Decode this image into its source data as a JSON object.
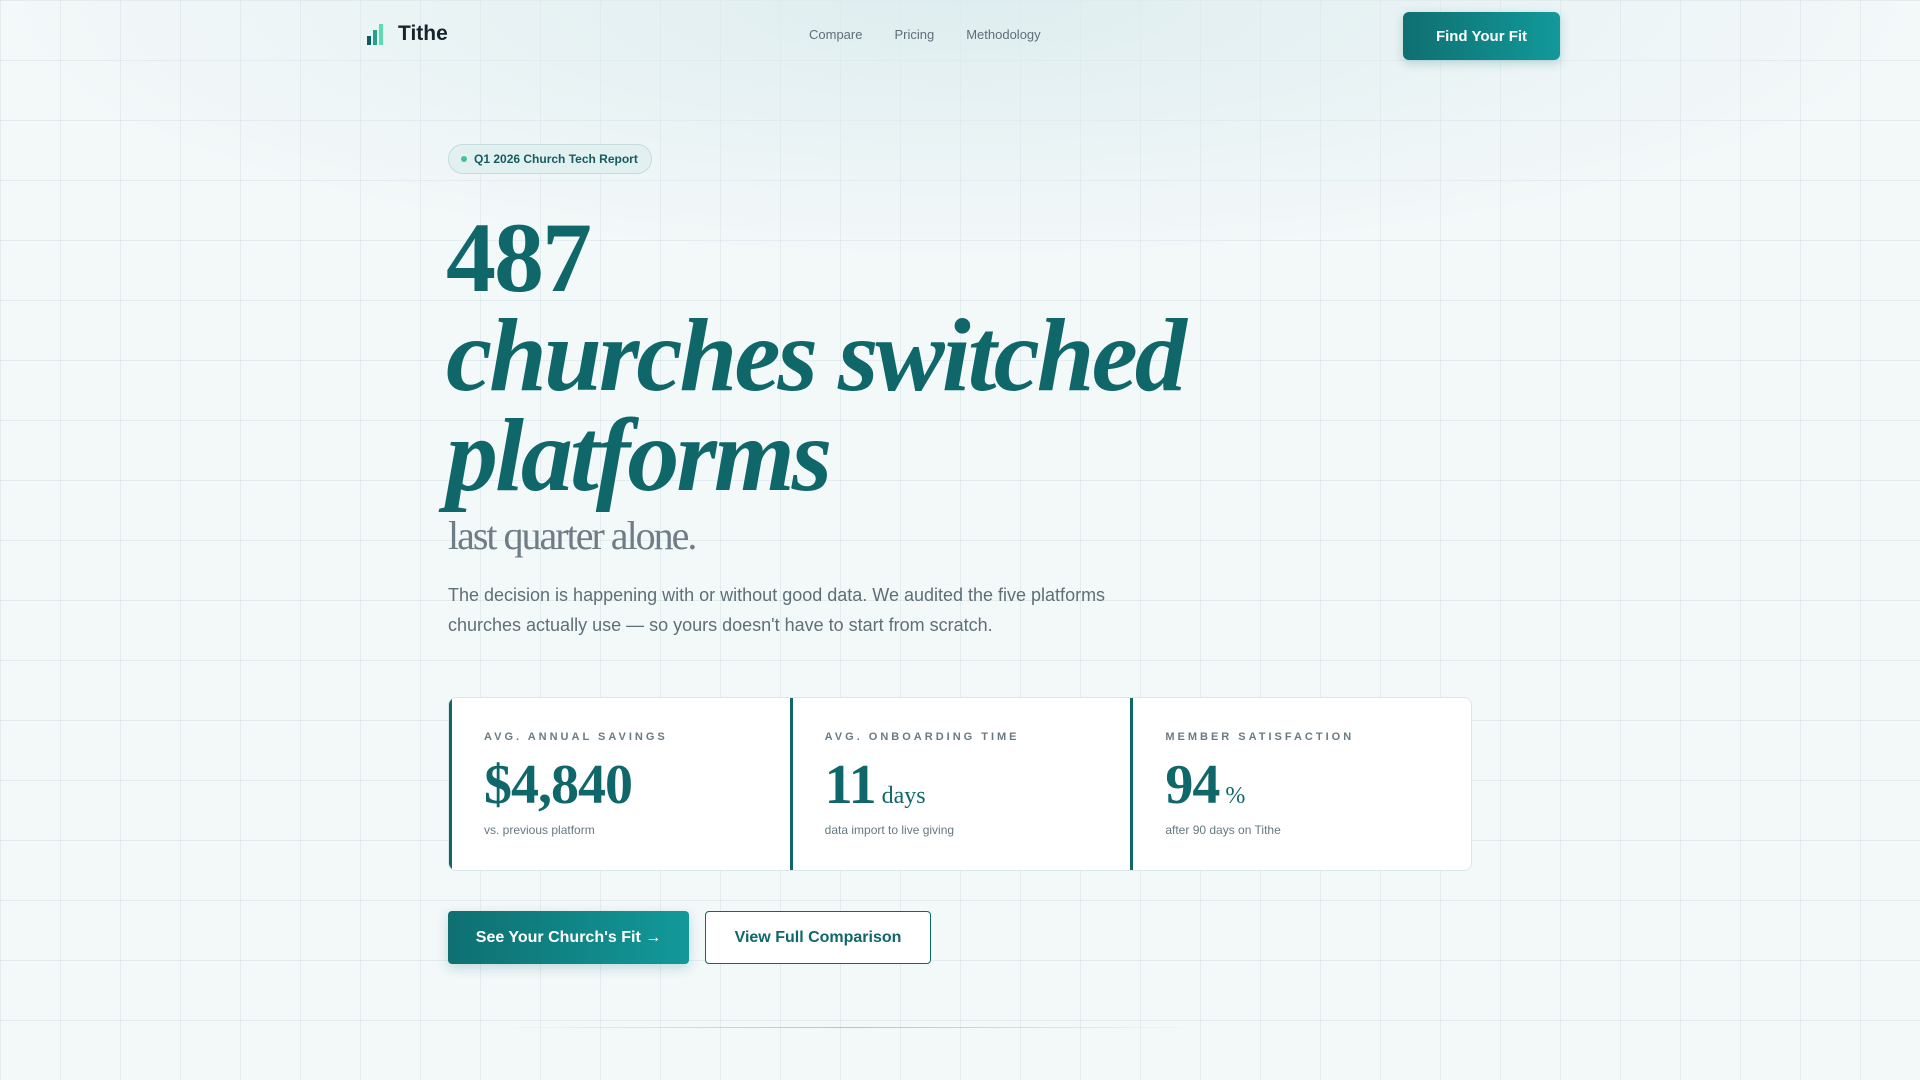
{
  "nav": {
    "brand": "Tithe",
    "links": [
      "Compare",
      "Pricing",
      "Methodology"
    ],
    "cta_label": "Find Your Fit"
  },
  "hero": {
    "badge": "Q1 2026 Church Tech Report",
    "number": "487",
    "headline_line1": "churches switched",
    "headline_line2": "platforms",
    "tail": "last quarter alone.",
    "description": "The decision is happening with or without good data. We audited the five platforms churches actually use — so yours doesn't have to start from scratch."
  },
  "stats": [
    {
      "label": "AVG. ANNUAL SAVINGS",
      "value": "$4,840",
      "unit": "",
      "sub": "vs. previous platform"
    },
    {
      "label": "AVG. ONBOARDING TIME",
      "value": "11",
      "unit": "days",
      "sub": "data import to live giving"
    },
    {
      "label": "MEMBER SATISFACTION",
      "value": "94",
      "unit": "%",
      "sub": "after 90 days on Tithe"
    }
  ],
  "ctas": {
    "primary_label": "See Your Church's Fit →",
    "secondary_label": "View Full Comparison"
  },
  "colors": {
    "accent": "#10676a",
    "accent_light": "#12999a",
    "badge_dot": "#3fc49a",
    "background": "#f3f8f9"
  },
  "icons": {
    "brand": "bar-chart-logo-icon"
  }
}
